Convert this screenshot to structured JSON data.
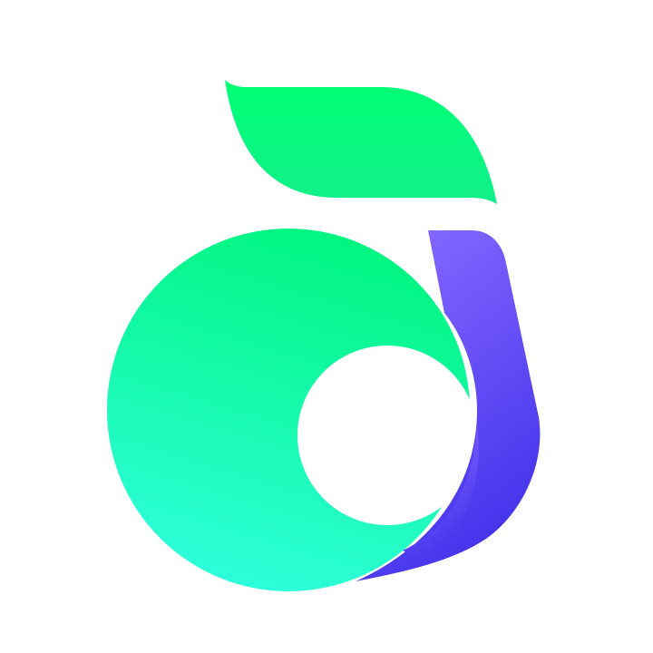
{
  "canvas": {
    "background": "#ffffff"
  },
  "logo": {
    "icon_name": "abstract-leaf-circle-logo-icon",
    "colors": {
      "leaf_top": "#00FF74",
      "leaf_bottom": "#12F08A",
      "circle_top": "#00F57E",
      "circle_bottom": "#2EFFDC",
      "tail_top": "#8568FF",
      "tail_bottom": "#3F2FEA"
    }
  }
}
